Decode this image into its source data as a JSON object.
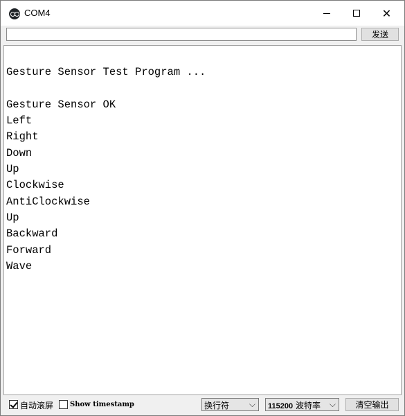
{
  "window": {
    "title": "COM4",
    "app_icon": "arduino-icon",
    "controls": {
      "minimize": "—",
      "maximize": "□",
      "close": "✕"
    }
  },
  "send_bar": {
    "input_value": "",
    "send_label": "发送"
  },
  "output": {
    "lines": [
      "",
      "Gesture Sensor Test Program ...",
      "",
      "Gesture Sensor OK",
      "Left",
      "Right",
      "Down",
      "Up",
      "Clockwise",
      "AntiClockwise",
      "Up",
      "Backward",
      "Forward",
      "Wave"
    ]
  },
  "status_bar": {
    "autoscroll_label": "自动滚屏",
    "autoscroll_checked": true,
    "timestamp_label": "Show timestamp",
    "timestamp_checked": false,
    "line_ending": "换行符",
    "baud_number": "115200",
    "baud_suffix": "波特率",
    "clear_label": "清空输出"
  }
}
